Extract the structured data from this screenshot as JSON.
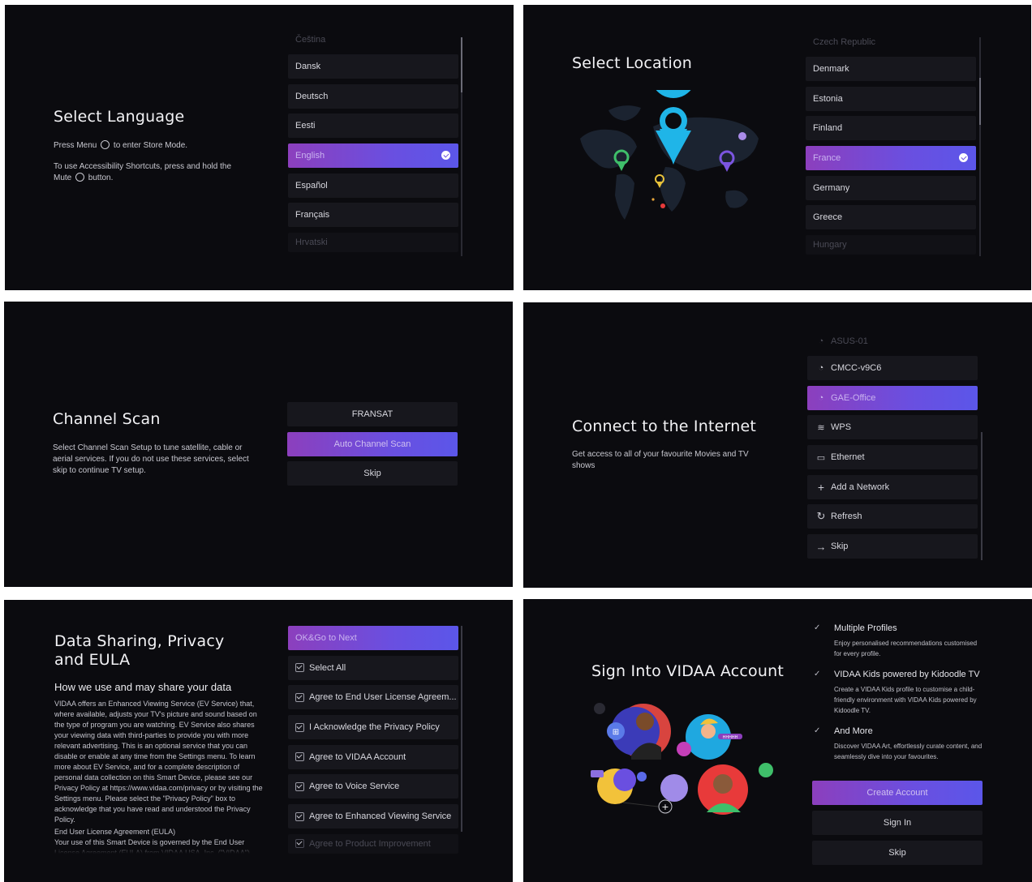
{
  "language": {
    "title": "Select Language",
    "store_mode_before": "Press Menu",
    "store_mode_after": "to enter Store Mode.",
    "access_line1": "To use Accessibility Shortcuts, press and hold the",
    "access_line2_before": "Mute",
    "access_line2_after": "button.",
    "items": [
      "Čeština",
      "Dansk",
      "Deutsch",
      "Eesti",
      "English",
      "Español",
      "Français",
      "Hrvatski"
    ]
  },
  "location": {
    "title": "Select Location",
    "items": [
      "Czech Republic",
      "Denmark",
      "Estonia",
      "Finland",
      "France",
      "Germany",
      "Greece",
      "Hungary"
    ]
  },
  "channel": {
    "title": "Channel Scan",
    "desc": "Select Channel Scan Setup to tune satellite, cable or aerial services. If you do not use these services, select skip to continue TV setup.",
    "buttons": [
      "FRANSAT",
      "Auto Channel Scan",
      "Skip"
    ]
  },
  "internet": {
    "title": "Connect to the Internet",
    "desc": "Get access to all of your favourite Movies and TV shows",
    "items": [
      "ASUS-01",
      "CMCC-v9C6",
      "GAE-Office",
      "WPS",
      "Ethernet",
      "Add a Network",
      "Refresh",
      "Skip"
    ]
  },
  "privacy": {
    "title": "Data Sharing, Privacy and EULA",
    "subtitle": "How we use and may share your data",
    "body": "VIDAA offers an Enhanced Viewing Service (EV Service) that, where available, adjusts your TV's picture and sound based on the type of program you are watching. EV Service also shares your viewing data with third-parties to provide you with more relevant advertising. This is an optional service that you can disable or enable at any time from the Settings menu. To learn more about EV Service, and for a complete description of personal data collection on this Smart Device, please see our Privacy Policy at https://www.vidaa.com/privacy or by visiting the Settings menu. Please select the \"Privacy Policy\" box to acknowledge that you have read and understood the Privacy Policy.",
    "eula_title": "End User License Agreement (EULA)",
    "eula_body": "Your use of this Smart Device is governed by the End User License Agreement (EULA) from VIDAA USA, Inc. (\"VIDAA\")",
    "items": [
      "OK&Go to Next",
      "Select All",
      "Agree to End User License Agreem...",
      "I Acknowledge the Privacy Policy",
      "Agree to VIDAA Account",
      "Agree to Voice Service",
      "Agree to Enhanced Viewing Service",
      "Agree to Product Improvement"
    ]
  },
  "vidaa": {
    "title": "Sign Into VIDAA Account",
    "features": [
      {
        "title": "Multiple Profiles",
        "desc": "Enjoy personalised recommendations customised for every profile."
      },
      {
        "title": "VIDAA Kids powered by Kidoodle TV",
        "desc": "Create a VIDAA Kids profile to customise a child-friendly environment with VIDAA Kids powered by Kidoodle TV."
      },
      {
        "title": "And More",
        "desc": "Discover VIDAA Art, effortlessly curate content, and seamlessly dive into your favourites."
      }
    ],
    "buttons": [
      "Create Account",
      "Sign In",
      "Skip"
    ],
    "plus_label": "+",
    "bubble_label": "HHHHH"
  },
  "colors": {
    "panel_bg": "#0b0b0f",
    "item_bg": "#17171d",
    "accent_start": "#8c3fbd",
    "accent_end": "#5b56e9",
    "map_pin": "#1fb5e8"
  },
  "icons": {
    "wifi": "wifi-lock-icon",
    "wps": "wps-icon",
    "ethernet": "ethernet-icon",
    "add": "plus-icon",
    "refresh": "refresh-icon",
    "skip": "arrow-right-icon"
  }
}
